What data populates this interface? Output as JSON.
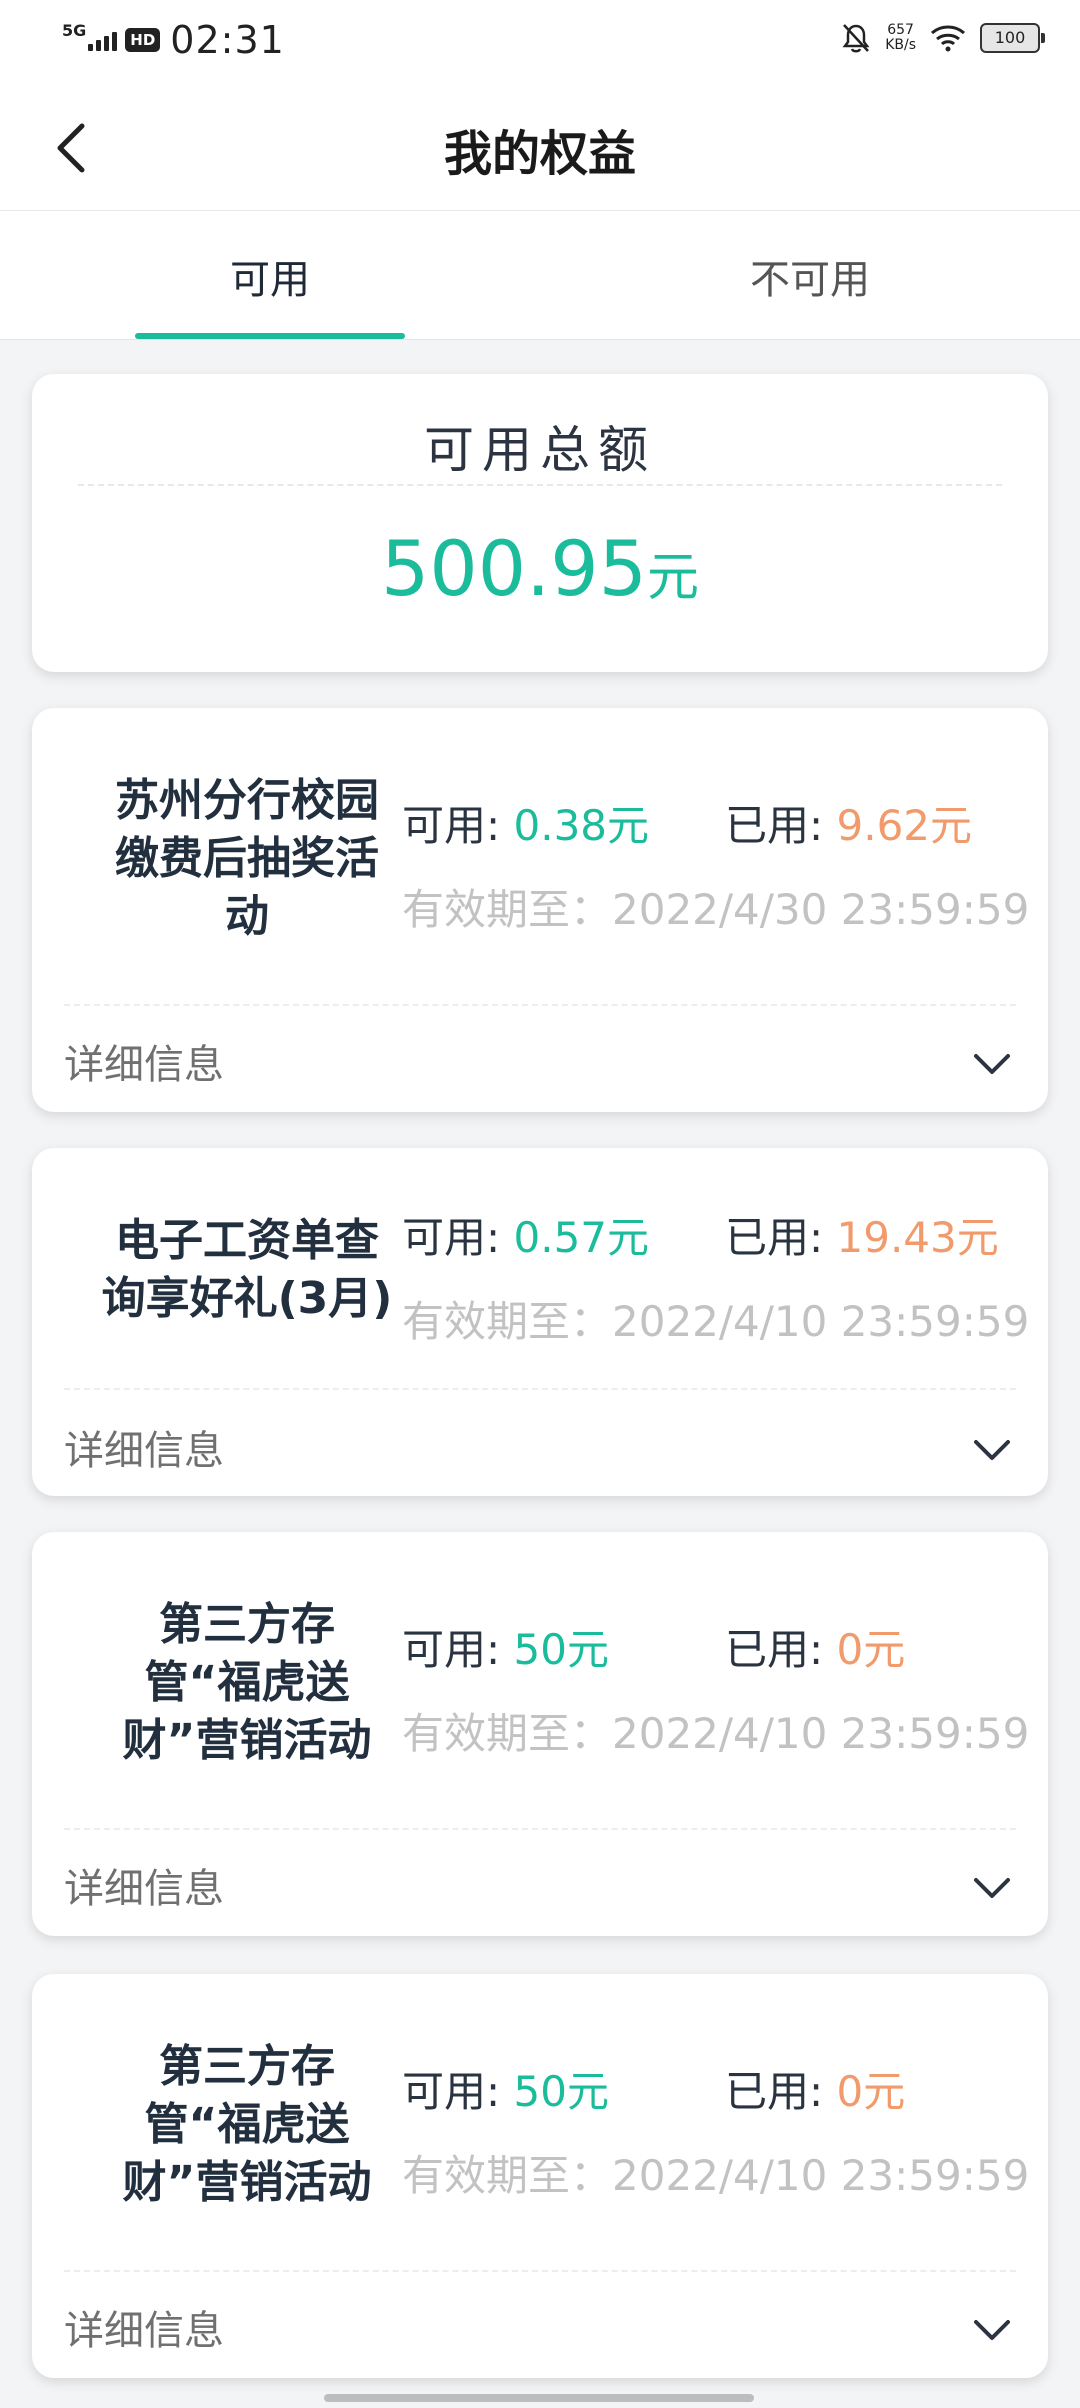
{
  "status_bar": {
    "network": "5G",
    "hd": "HD",
    "time": "02:31",
    "speed_value": "657",
    "speed_unit": "KB/s",
    "battery": "100"
  },
  "header": {
    "title": "我的权益"
  },
  "tabs": [
    {
      "label": "可用",
      "active": true
    },
    {
      "label": "不可用",
      "active": false
    }
  ],
  "summary": {
    "title": "可用总额",
    "amount": "500.95",
    "unit": "元"
  },
  "labels": {
    "available_prefix": "可用: ",
    "used_prefix": "已用: ",
    "details": "详细信息"
  },
  "promotions": [
    {
      "name_lines": [
        "苏州分行校园",
        "缴费后抽奖活",
        "动"
      ],
      "available": "0.38元",
      "used": "9.62元",
      "expiry": "有效期至：2022/4/30 23:59:59"
    },
    {
      "name_lines": [
        "电子工资单查",
        "询享好礼(3月)"
      ],
      "available": "0.57元",
      "used": "19.43元",
      "expiry": "有效期至：2022/4/10 23:59:59"
    },
    {
      "name_lines": [
        "第三方存",
        "管“福虎送",
        "财”营销活动"
      ],
      "available": "50元",
      "used": "0元",
      "expiry": "有效期至：2022/4/10 23:59:59"
    },
    {
      "name_lines": [
        "第三方存",
        "管“福虎送",
        "财”营销活动"
      ],
      "available": "50元",
      "used": "0元",
      "expiry": "有效期至：2022/4/10 23:59:59"
    }
  ],
  "colors": {
    "accent": "#1bbc9b",
    "used": "#f19a6b",
    "muted": "#c2c2c2"
  }
}
